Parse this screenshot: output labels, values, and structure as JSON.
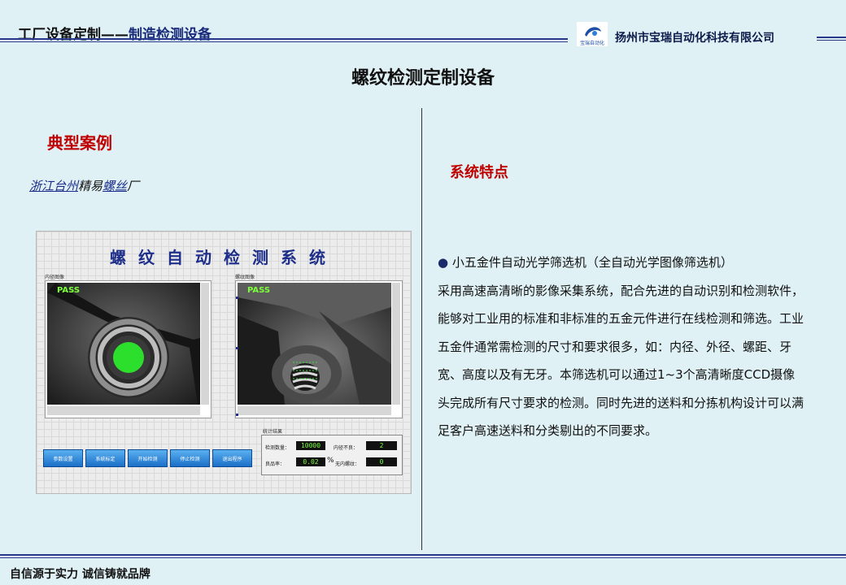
{
  "header": {
    "left_title": "工厂设备定制——",
    "left_subtitle": "制造检测设备",
    "logo_text": "宝瑞自动化",
    "company": "扬州市宝瑞自动化科技有限公司"
  },
  "page_title": "螺纹检测定制设备",
  "case": {
    "heading": "典型案例",
    "subtitle_parts": [
      "浙江台州",
      "精易",
      "螺丝",
      "厂"
    ]
  },
  "screenshot": {
    "title": "螺纹自动检测系统",
    "panel_left_label": "内径图像",
    "panel_right_label": "螺纹图像",
    "pass_left": "PASS",
    "pass_right": "PASS",
    "buttons": [
      "参数设置",
      "系统标定",
      "开始检测",
      "停止检测",
      "退出程序"
    ],
    "stats": {
      "title": "统计结果",
      "count_label": "检测数量：",
      "count_value": "10000",
      "bad_label": "内径不良：",
      "bad_value": "2",
      "yield_label": "良品率：",
      "yield_value": "0.02",
      "percent": "%",
      "nothread_label": "无内螺纹：",
      "nothread_value": "0"
    }
  },
  "features": {
    "heading": "系统特点",
    "bullet": "●",
    "first_line": "小五金件自动光学筛选机（全自动光学图像筛选机）",
    "body": "采用高速高清晰的影像采集系统，配合先进的自动识别和检测软件，能够对工业用的标准和非标准的五金元件进行在线检测和筛选。工业五金件通常需检测的尺寸和要求很多，如：内径、外径、螺距、牙宽、高度以及有无牙。本筛选机可以通过1~3个高清晰度CCD摄像头完成所有尺寸要求的检测。同时先进的送料和分拣机构设计可以满足客户高速送料和分类剔出的不同要求。"
  },
  "footer": "自信源于实力  诚信铸就品牌",
  "colors": {
    "background": "#dff1f5",
    "heading_red": "#c00000",
    "rule_blue": "#2a3a8a",
    "button_blue": "#1b6fc8"
  }
}
